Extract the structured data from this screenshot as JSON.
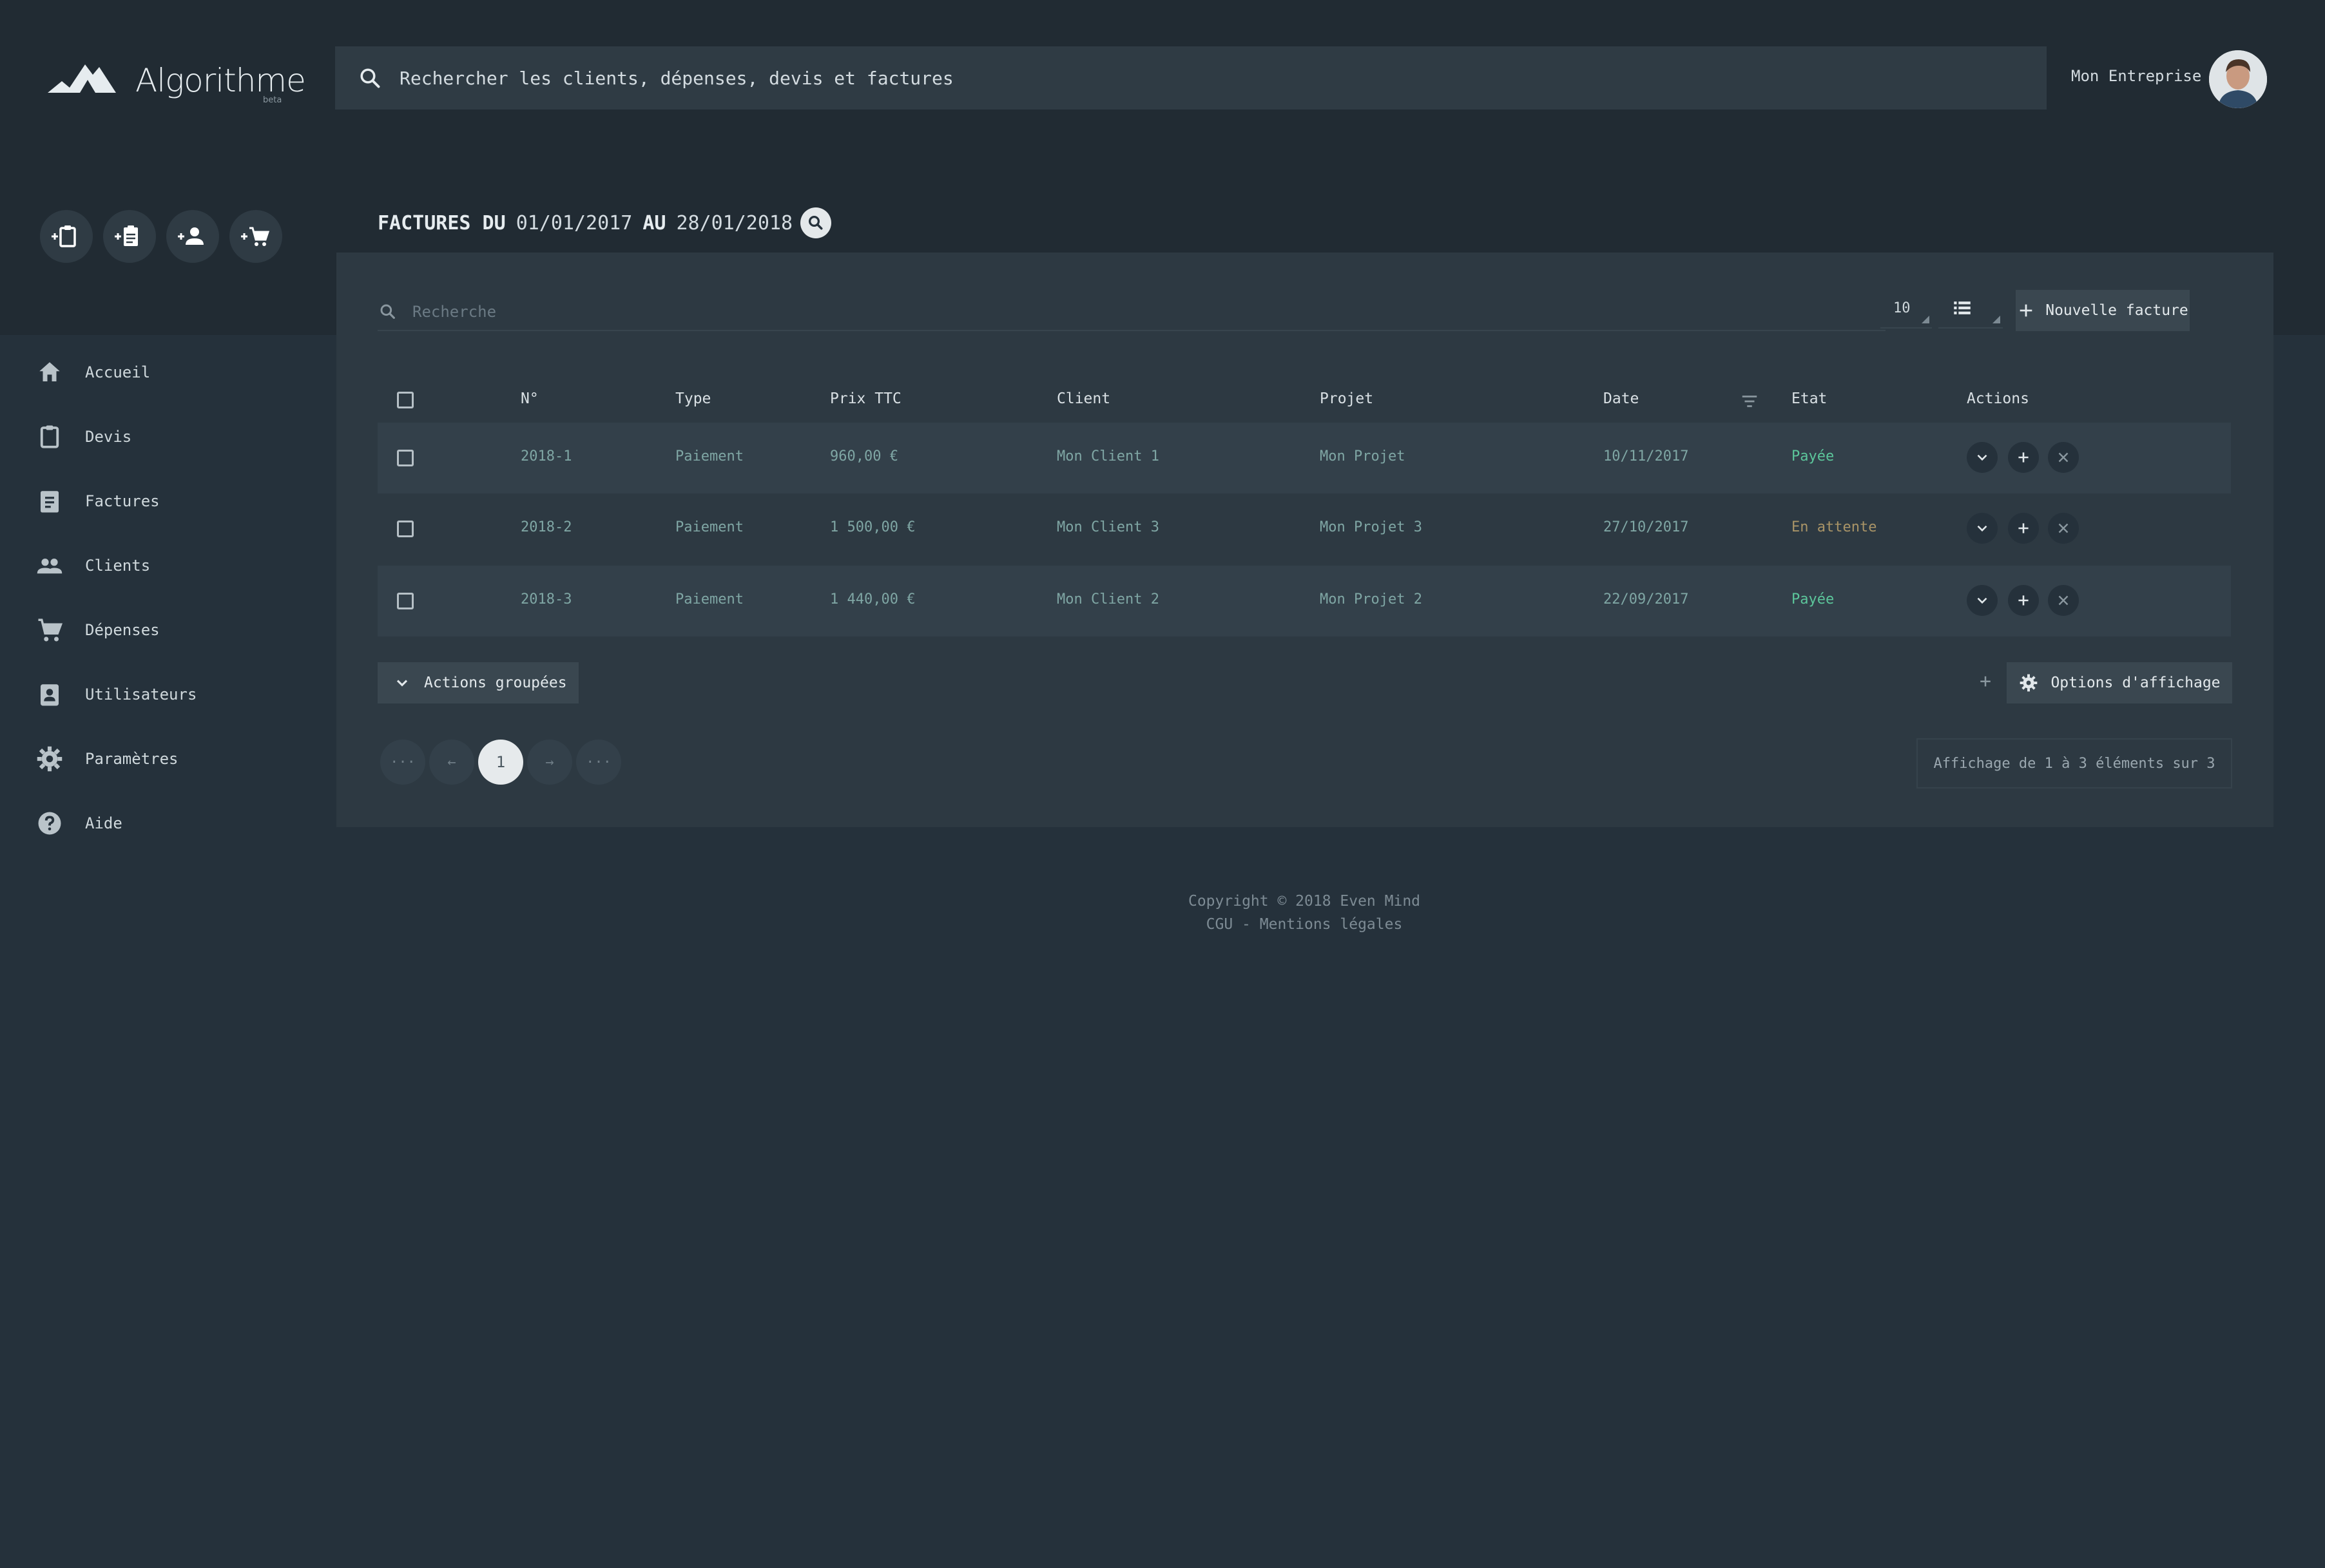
{
  "brand": {
    "name": "Algorithme",
    "badge": "beta"
  },
  "top_search": {
    "placeholder": "Rechercher les clients, dépenses, devis et factures"
  },
  "user": {
    "company": "Mon Entreprise"
  },
  "quick_actions": [
    {
      "icon": "add-quote-icon"
    },
    {
      "icon": "add-invoice-icon"
    },
    {
      "icon": "add-client-icon"
    },
    {
      "icon": "add-expense-icon"
    }
  ],
  "sidebar": {
    "items": [
      {
        "label": "Accueil",
        "icon": "home-icon"
      },
      {
        "label": "Devis",
        "icon": "clipboard-icon"
      },
      {
        "label": "Factures",
        "icon": "invoice-icon"
      },
      {
        "label": "Clients",
        "icon": "people-icon"
      },
      {
        "label": "Dépenses",
        "icon": "cart-icon"
      },
      {
        "label": "Utilisateurs",
        "icon": "user-badge-icon"
      },
      {
        "label": "Paramètres",
        "icon": "gear-icon"
      },
      {
        "label": "Aide",
        "icon": "help-icon"
      }
    ]
  },
  "page": {
    "title_prefix": "FACTURES DU",
    "date_from": "01/01/2017",
    "title_mid": "AU",
    "date_to": "28/01/2018"
  },
  "toolbar": {
    "search_placeholder": "Recherche",
    "per_page": "10",
    "new_label": "Nouvelle facture"
  },
  "table": {
    "columns": [
      "N°",
      "Type",
      "Prix TTC",
      "Client",
      "Projet",
      "Date",
      "Etat",
      "Actions"
    ],
    "rows": [
      {
        "num": "2018-1",
        "type": "Paiement",
        "price": "960,00 €",
        "client": "Mon Client 1",
        "project": "Mon Projet",
        "date": "10/11/2017",
        "status": "Payée"
      },
      {
        "num": "2018-2",
        "type": "Paiement",
        "price": "1 500,00 €",
        "client": "Mon Client 3",
        "project": "Mon Projet 3",
        "date": "27/10/2017",
        "status": "En attente"
      },
      {
        "num": "2018-3",
        "type": "Paiement",
        "price": "1 440,00 €",
        "client": "Mon Client 2",
        "project": "Mon Projet 2",
        "date": "22/09/2017",
        "status": "Payée"
      }
    ]
  },
  "bulk": {
    "label": "Actions groupées"
  },
  "display_options": {
    "plus": "+",
    "label": "Options d'affichage"
  },
  "pagination": {
    "first": "···",
    "prev": "←",
    "current": "1",
    "next": "→",
    "last": "···"
  },
  "count_text": "Affichage de 1 à 3 éléments sur 3",
  "footer": {
    "copyright": "Copyright © 2018 Even Mind",
    "links": "CGU - Mentions légales"
  },
  "colors": {
    "paid": "#5cc69b",
    "pending": "#a99467",
    "accent": "#7fa6a4"
  }
}
